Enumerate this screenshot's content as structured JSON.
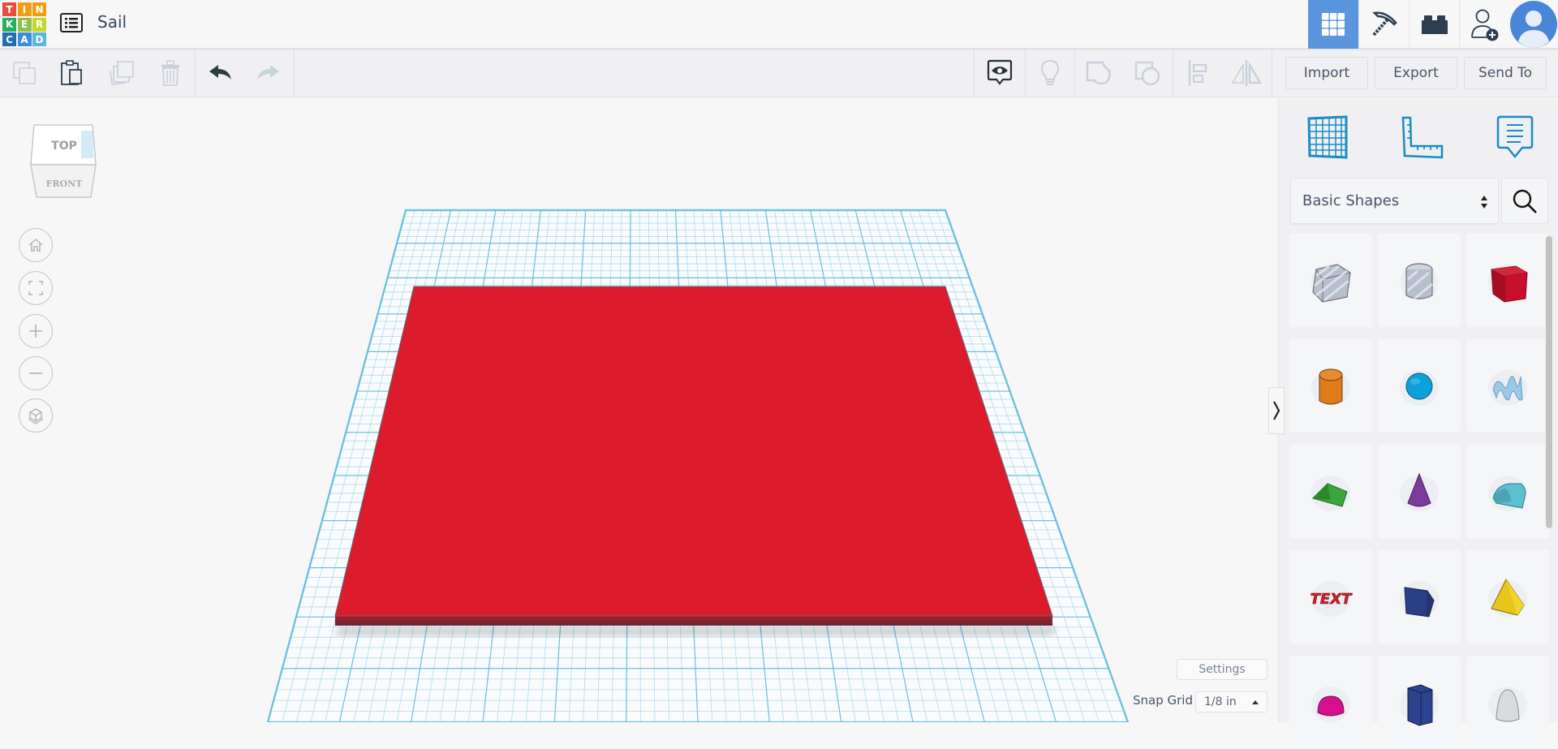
{
  "app": {
    "logo_letters": [
      "T",
      "I",
      "N",
      "K",
      "E",
      "R",
      "C",
      "A",
      "D"
    ],
    "logo_colors": [
      "#e74c3c",
      "#f39c12",
      "#f39c12",
      "#27ae60",
      "#8bc34a",
      "#c0d72f",
      "#1e6fb0",
      "#3d8ed8",
      "#5cb5e0"
    ],
    "design_title": "Sail"
  },
  "topbar": {
    "buttons": [
      {
        "name": "3d-design-view",
        "icon": "grid-icon",
        "active": true
      },
      {
        "name": "blocks-view",
        "icon": "pickaxe-icon",
        "active": false
      },
      {
        "name": "bricks-view",
        "icon": "brick-icon",
        "active": false
      },
      {
        "name": "invite-user",
        "icon": "add-user-icon",
        "active": false
      }
    ],
    "avatar_color": "#4a86d8"
  },
  "toolbar": {
    "left_tools": [
      {
        "name": "copy",
        "icon": "copy-icon",
        "enabled": false
      },
      {
        "name": "paste",
        "icon": "paste-icon",
        "enabled": true
      },
      {
        "name": "duplicate",
        "icon": "duplicate-icon",
        "enabled": false
      },
      {
        "name": "delete",
        "icon": "trash-icon",
        "enabled": false
      },
      {
        "name": "undo",
        "icon": "undo-icon",
        "enabled": true
      },
      {
        "name": "redo",
        "icon": "redo-icon",
        "enabled": false
      }
    ],
    "right_tools": [
      {
        "name": "show-all",
        "icon": "eye-icon",
        "enabled": true
      },
      {
        "name": "notes",
        "icon": "lightbulb-icon",
        "enabled": false
      },
      {
        "name": "group",
        "icon": "group-icon",
        "enabled": false
      },
      {
        "name": "ungroup",
        "icon": "ungroup-icon",
        "enabled": false
      },
      {
        "name": "align",
        "icon": "align-icon",
        "enabled": false
      },
      {
        "name": "mirror",
        "icon": "mirror-icon",
        "enabled": false
      }
    ],
    "import_label": "Import",
    "export_label": "Export",
    "send_to_label": "Send To"
  },
  "viewcube": {
    "top_label": "TOP",
    "front_label": "FRONT"
  },
  "nav_controls": [
    {
      "name": "home-view",
      "icon": "home-icon"
    },
    {
      "name": "fit-view",
      "icon": "fit-icon"
    },
    {
      "name": "zoom-in",
      "icon": "plus-icon"
    },
    {
      "name": "zoom-out",
      "icon": "minus-icon"
    },
    {
      "name": "perspective",
      "icon": "cube-icon"
    }
  ],
  "workplane": {
    "settings_label": "Settings",
    "snap_grid_label": "Snap Grid",
    "snap_grid_value": "1/8 in",
    "object_color": "#dc1c2c",
    "grid_color": "#5bb8dc"
  },
  "panel": {
    "icons": [
      {
        "name": "workplane-tool",
        "icon": "workplane-icon"
      },
      {
        "name": "ruler-tool",
        "icon": "ruler-icon"
      },
      {
        "name": "notes-tool",
        "icon": "note-icon"
      }
    ],
    "category": "Basic Shapes",
    "shapes": [
      {
        "name": "box-hole",
        "color": "#b8bfcc"
      },
      {
        "name": "cylinder-hole",
        "color": "#b8bfcc"
      },
      {
        "name": "box",
        "color": "#c8102e"
      },
      {
        "name": "cylinder",
        "color": "#e07b1a"
      },
      {
        "name": "sphere",
        "color": "#0ea0d8"
      },
      {
        "name": "scribble",
        "color": "#9cc8e8"
      },
      {
        "name": "roof",
        "color": "#3aa53a"
      },
      {
        "name": "cone",
        "color": "#7b3a9c"
      },
      {
        "name": "round-roof",
        "color": "#5bc0d0"
      },
      {
        "name": "text",
        "color": "#d0202a"
      },
      {
        "name": "wedge",
        "color": "#2a3f86"
      },
      {
        "name": "pyramid",
        "color": "#e8c51a"
      },
      {
        "name": "half-sphere",
        "color": "#d6108c"
      },
      {
        "name": "polygon",
        "color": "#2c4390"
      },
      {
        "name": "paraboloid",
        "color": "#d8dadc"
      }
    ]
  }
}
